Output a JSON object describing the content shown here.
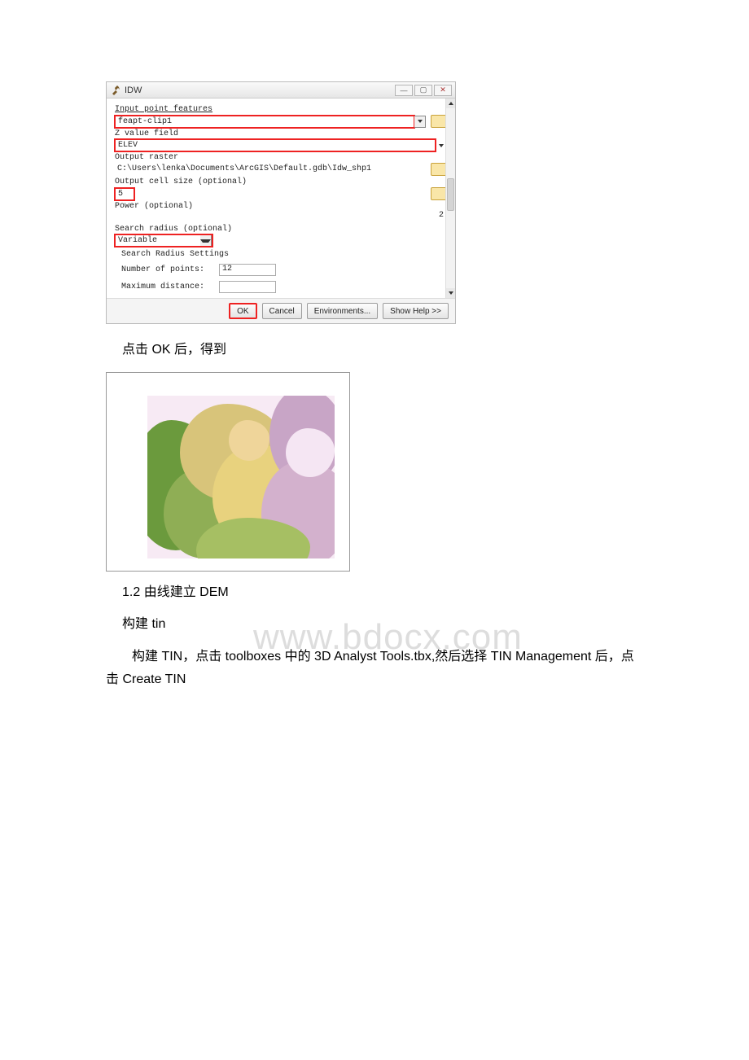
{
  "dialog": {
    "title": "IDW",
    "labels": {
      "input_features": "Input point features",
      "z_field": "Z value field",
      "out_raster": "Output raster",
      "cell_size": "Output cell size (optional)",
      "power": "Power (optional)",
      "search_radius": "Search radius (optional)",
      "srs": "Search Radius Settings",
      "num_points": "Number of points:",
      "max_dist": "Maximum distance:"
    },
    "values": {
      "input_features": "feapt-clip1",
      "z_field": "ELEV",
      "out_raster": "C:\\Users\\lenka\\Documents\\ArcGIS\\Default.gdb\\Idw_shp1",
      "cell_size": "5",
      "power": "2",
      "search_type": "Variable",
      "num_points": "12",
      "max_dist": ""
    },
    "buttons": {
      "ok": "OK",
      "cancel": "Cancel",
      "env": "Environments...",
      "help": "Show Help >>"
    }
  },
  "text": {
    "p1": "点击 OK 后，得到",
    "p2": "1.2 由线建立 DEM",
    "p3": "构建 tin",
    "p4": "构建 TIN，点击 toolboxes 中的 3D Analyst Tools.tbx,然后选择 TIN Management 后，点击 Create TIN"
  },
  "watermark": "www.bdocx.com"
}
